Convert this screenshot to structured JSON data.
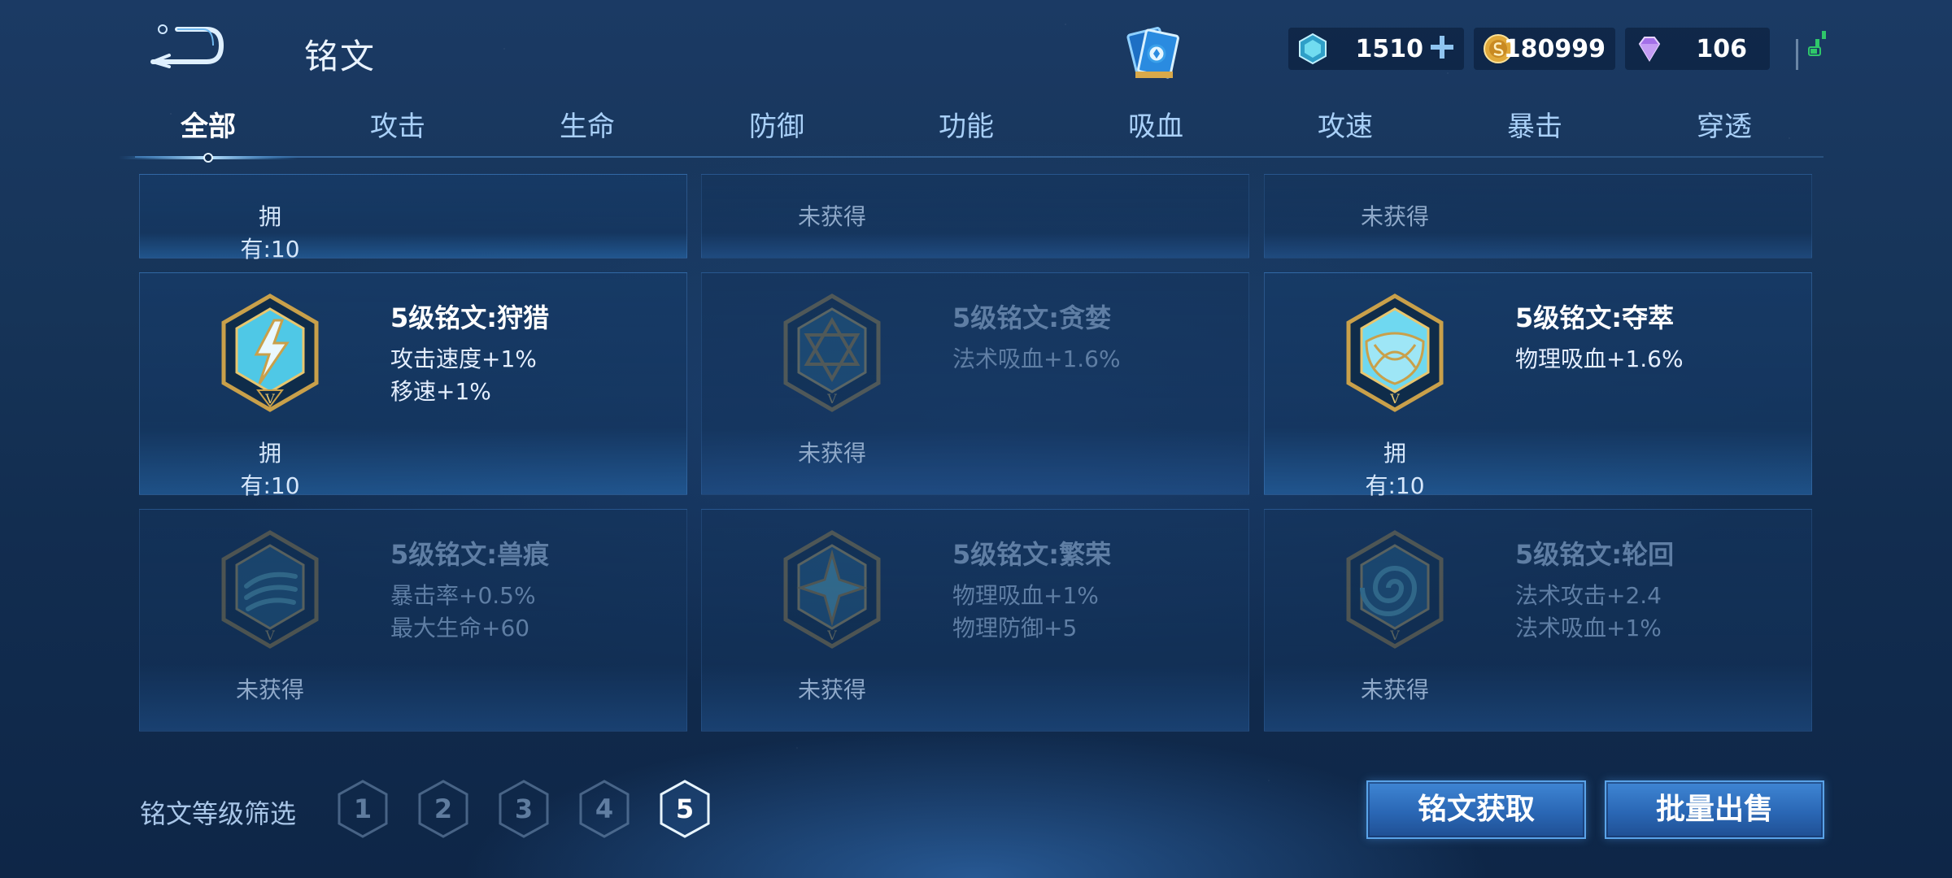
{
  "header": {
    "title": "铭文",
    "back_icon": "back-arrow-icon",
    "currencies": [
      {
        "name": "gem",
        "value": "1510",
        "icon": "gem-coupon-icon",
        "color": "#47c6e6"
      },
      {
        "name": "coin",
        "value": "180999",
        "icon": "gold-coin-icon",
        "color": "#e0a93a"
      },
      {
        "name": "diamond",
        "value": "106",
        "icon": "purple-diamond-icon",
        "color": "#b184f0"
      }
    ]
  },
  "tabs": [
    {
      "label": "全部",
      "active": true
    },
    {
      "label": "攻击"
    },
    {
      "label": "生命"
    },
    {
      "label": "防御"
    },
    {
      "label": "功能"
    },
    {
      "label": "吸血"
    },
    {
      "label": "攻速"
    },
    {
      "label": "暴击"
    },
    {
      "label": "穿透"
    }
  ],
  "partial_row": [
    {
      "status": "拥有:10"
    },
    {
      "status": "未获得"
    },
    {
      "status": "未获得"
    }
  ],
  "cards": [
    {
      "title": "5级铭文:狩猎",
      "stats": [
        "攻击速度+1%",
        "移速+1%"
      ],
      "status": "拥有:10",
      "owned": true,
      "icon": "hunt-lightning-emblem-icon"
    },
    {
      "title": "5级铭文:贪婪",
      "stats": [
        "法术吸血+1.6%"
      ],
      "status": "未获得",
      "owned": false,
      "icon": "greed-star-emblem-icon"
    },
    {
      "title": "5级铭文:夺萃",
      "stats": [
        "物理吸血+1.6%"
      ],
      "status": "拥有:10",
      "owned": true,
      "icon": "seize-knot-emblem-icon"
    },
    {
      "title": "5级铭文:兽痕",
      "stats": [
        "暴击率+0.5%",
        "最大生命+60"
      ],
      "status": "未获得",
      "owned": false,
      "icon": "beast-claw-emblem-icon"
    },
    {
      "title": "5级铭文:繁荣",
      "stats": [
        "物理吸血+1%",
        "物理防御+5"
      ],
      "status": "未获得",
      "owned": false,
      "icon": "prosper-star-emblem-icon"
    },
    {
      "title": "5级铭文:轮回",
      "stats": [
        "法术攻击+2.4",
        "法术吸血+1%"
      ],
      "status": "未获得",
      "owned": false,
      "icon": "cycle-swirl-emblem-icon"
    }
  ],
  "emblem_level_mark": "V",
  "footer": {
    "filter_label": "铭文等级筛选",
    "levels": [
      "1",
      "2",
      "3",
      "4",
      "5"
    ],
    "active_level": "5",
    "get_button": "铭文获取",
    "sell_button": "批量出售"
  },
  "colors": {
    "accent": "#5aa3e8",
    "owned_crystal": "#5fd6ee",
    "gold_frame": "#c9a04a",
    "button": "#2a67b5"
  }
}
